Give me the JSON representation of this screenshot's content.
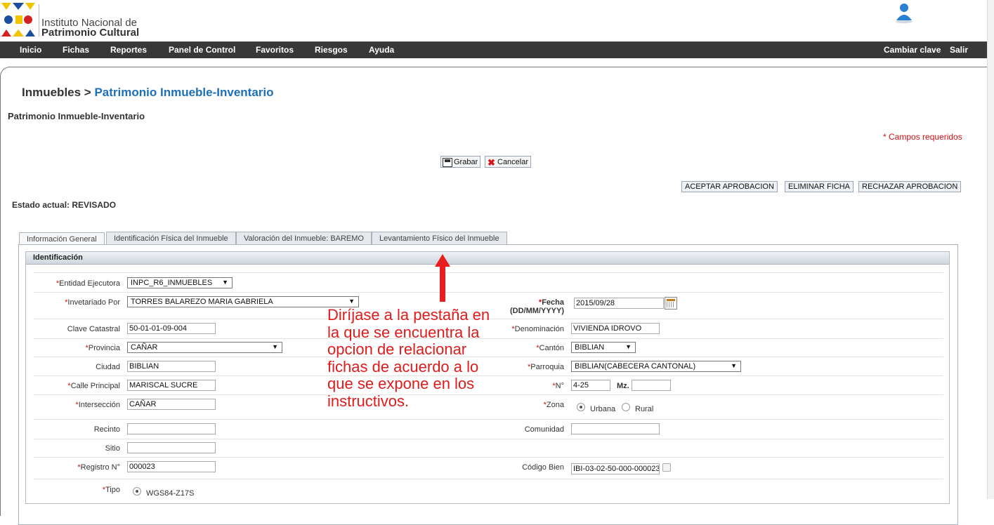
{
  "header": {
    "org_line1": "Instituto Nacional de",
    "org_line2": "Patrimonio Cultural",
    "logo_icon": "inpc-logo-icon",
    "user_icon": "user-icon",
    "colors": {
      "nav_bg": "#383838",
      "accent_blue": "#1d6fb8",
      "required_red": "#cc1111",
      "annotation_red": "#e01b1b"
    }
  },
  "nav": {
    "items": [
      "Inicio",
      "Fichas",
      "Reportes",
      "Panel de Control",
      "Favoritos",
      "Riesgos",
      "Ayuda"
    ],
    "right": [
      "Cambiar clave",
      "Salir"
    ]
  },
  "page": {
    "breadcrumb_parent": "Inmuebles >",
    "breadcrumb_current": "Patrimonio Inmueble-Inventario",
    "subtitle": "Patrimonio Inmueble-Inventario",
    "required_note": "* Campos requeridos",
    "estado": "Estado actual: REVISADO"
  },
  "toolbar": {
    "save_label": "Grabar",
    "cancel_label": "Cancelar",
    "accept": "ACEPTAR APROBACION",
    "delete": "ELIMINAR FICHA",
    "reject": "RECHAZAR APROBACION"
  },
  "tabs": [
    "Información General",
    "Identificación Física del Inmueble",
    "Valoración del Inmueble: BAREMO",
    "Levantamiento Físico del Inmueble"
  ],
  "section": {
    "title": "Identificación"
  },
  "form": {
    "entidad_label": "Entidad Ejecutora",
    "entidad_value": "INPC_R6_INMUEBLES",
    "inventariado_label": "Invetariado Por",
    "inventariado_value": "TORRES BALAREZO MARIA GABRIELA",
    "fecha_label": "Fecha",
    "fecha_format": "(DD/MM/YYYY)",
    "fecha_value": "2015/09/28",
    "clave_label": "Clave Catastral",
    "clave_value": "50-01-01-09-004",
    "denominacion_label": "Denominación",
    "denominacion_value": "VIVIENDA IDROVO",
    "provincia_label": "Provincia",
    "provincia_value": "CAÑAR",
    "canton_label": "Cantón",
    "canton_value": "BIBLIAN",
    "ciudad_label": "Ciudad",
    "ciudad_value": "BIBLIAN",
    "parroquia_label": "Parroquia",
    "parroquia_value": "BIBLIAN(CABECERA CANTONAL)",
    "calle_label": "Calle Principal",
    "calle_value": "MARISCAL SUCRE",
    "numero_label": "N°",
    "numero_value": "4-25",
    "mz_label": "Mz.",
    "mz_value": "",
    "interseccion_label": "Intersección",
    "interseccion_value": "CAÑAR",
    "zona_label": "Zona",
    "zona_urbana": "Urbana",
    "zona_rural": "Rural",
    "recinto_label": "Recinto",
    "recinto_value": "",
    "comunidad_label": "Comunidad",
    "comunidad_value": "",
    "sitio_label": "Sitio",
    "sitio_value": "",
    "registro_label": "Registro N°",
    "registro_value": "000023",
    "codigo_label": "Código Bien",
    "codigo_value": "IBI-03-02-50-000-000023",
    "tipo_label": "Tipo",
    "tipo_value": "WGS84-Z17S"
  },
  "annotation": {
    "text": "Diríjase a la pestaña en la que se encuentra la opcion de relacionar fichas de acuerdo a lo que se expone en los instructivos."
  }
}
